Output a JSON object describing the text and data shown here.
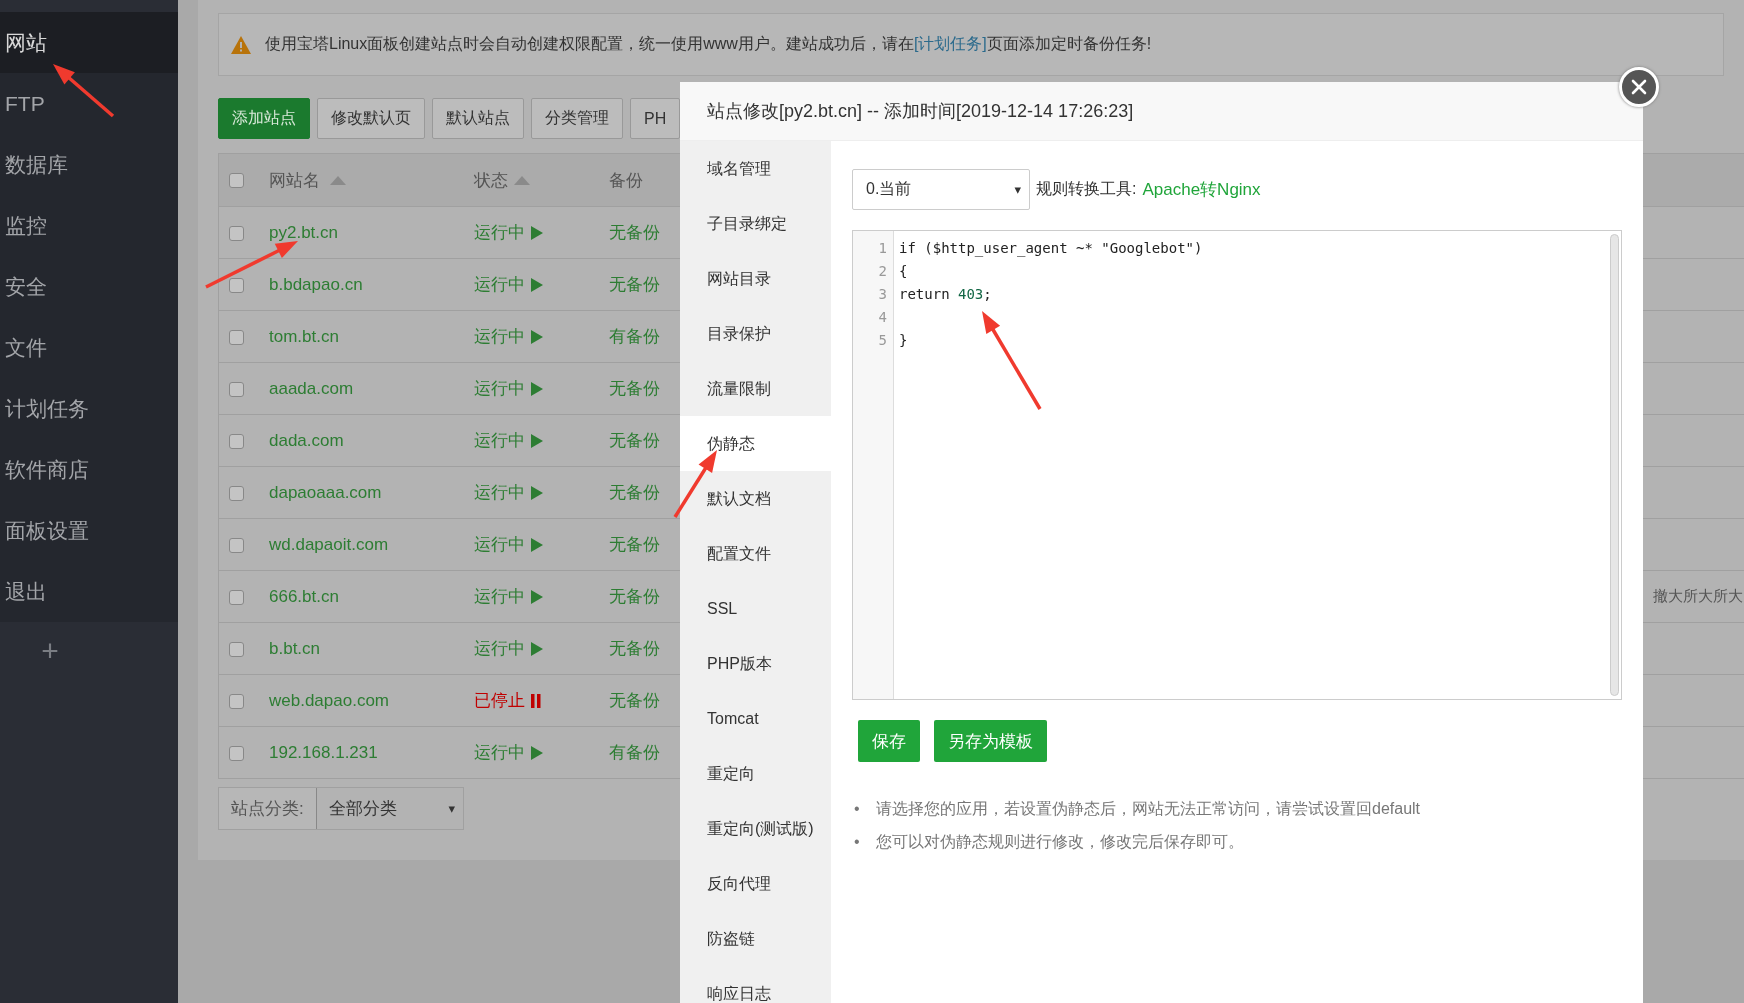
{
  "sidebar": {
    "items": [
      {
        "label": "网站",
        "selected": true
      },
      {
        "label": "FTP",
        "selected": false
      },
      {
        "label": "数据库",
        "selected": false
      },
      {
        "label": "监控",
        "selected": false
      },
      {
        "label": "安全",
        "selected": false
      },
      {
        "label": "文件",
        "selected": false
      },
      {
        "label": "计划任务",
        "selected": false
      },
      {
        "label": "软件商店",
        "selected": false
      },
      {
        "label": "面板设置",
        "selected": false
      },
      {
        "label": "退出",
        "selected": false
      }
    ],
    "add_label": "+"
  },
  "notice": {
    "before": "使用宝塔Linux面板创建站点时会自动创建权限配置，统一使用www用户。建站成功后，请在",
    "link": "[计划任务]",
    "after": "页面添加定时备份任务!"
  },
  "toolbar": [
    {
      "label": "添加站点",
      "kind": "primary"
    },
    {
      "label": "修改默认页",
      "kind": "plain"
    },
    {
      "label": "默认站点",
      "kind": "plain"
    },
    {
      "label": "分类管理",
      "kind": "plain"
    },
    {
      "label": "PH",
      "kind": "plain"
    }
  ],
  "table": {
    "columns": [
      "网站名",
      "状态",
      "备份"
    ],
    "all_checked": false,
    "rows": [
      {
        "checked": false,
        "name": "py2.bt.cn",
        "status": "运行中",
        "running": true,
        "backup": "无备份"
      },
      {
        "checked": false,
        "name": "b.bdapao.cn",
        "status": "运行中",
        "running": true,
        "backup": "无备份"
      },
      {
        "checked": false,
        "name": "tom.bt.cn",
        "status": "运行中",
        "running": true,
        "backup": "有备份"
      },
      {
        "checked": false,
        "name": "aaada.com",
        "status": "运行中",
        "running": true,
        "backup": "无备份"
      },
      {
        "checked": false,
        "name": "dada.com",
        "status": "运行中",
        "running": true,
        "backup": "无备份"
      },
      {
        "checked": false,
        "name": "dapaoaaa.com",
        "status": "运行中",
        "running": true,
        "backup": "无备份"
      },
      {
        "checked": false,
        "name": "wd.dapaoit.com",
        "status": "运行中",
        "running": true,
        "backup": "无备份"
      },
      {
        "checked": false,
        "name": "666.bt.cn",
        "status": "运行中",
        "running": true,
        "backup": "无备份",
        "column_5": "撤大所大所大"
      },
      {
        "checked": false,
        "name": "b.bt.cn",
        "status": "运行中",
        "running": true,
        "backup": "无备份"
      },
      {
        "checked": false,
        "name": "web.dapao.com",
        "status": "已停止",
        "running": false,
        "backup": "无备份"
      },
      {
        "checked": false,
        "name": "192.168.1.231",
        "status": "运行中",
        "running": true,
        "backup": "有备份"
      }
    ]
  },
  "filter": {
    "label": "站点分类:",
    "value": "全部分类",
    "caret": "▾"
  },
  "dialog": {
    "title": "站点修改[py2.bt.cn] -- 添加时间[2019-12-14 17:26:23]",
    "nav": [
      {
        "label": "域名管理",
        "selected": false
      },
      {
        "label": "子目录绑定",
        "selected": false
      },
      {
        "label": "网站目录",
        "selected": false
      },
      {
        "label": "目录保护",
        "selected": false
      },
      {
        "label": "流量限制",
        "selected": false
      },
      {
        "label": "伪静态",
        "selected": true
      },
      {
        "label": "默认文档",
        "selected": false
      },
      {
        "label": "配置文件",
        "selected": false
      },
      {
        "label": "SSL",
        "selected": false
      },
      {
        "label": "PHP版本",
        "selected": false
      },
      {
        "label": "Tomcat",
        "selected": false
      },
      {
        "label": "重定向",
        "selected": false
      },
      {
        "label": "重定向(测试版)",
        "selected": false
      },
      {
        "label": "反向代理",
        "selected": false
      },
      {
        "label": "防盗链",
        "selected": false
      },
      {
        "label": "响应日志",
        "selected": false
      }
    ],
    "template_select": {
      "value": "0.当前",
      "caret": "▾"
    },
    "tool_label": "规则转换工具:",
    "tool_link": "Apache转Nginx",
    "code": [
      {
        "number": "1",
        "tokens": [
          {
            "text": "if ($http_user_agent ~* \"Googlebot\")",
            "kind": "plain"
          }
        ]
      },
      {
        "number": "2",
        "tokens": [
          {
            "text": "{",
            "kind": "plain"
          }
        ]
      },
      {
        "number": "3",
        "tokens": [
          {
            "text": "return ",
            "kind": "plain"
          },
          {
            "text": "403",
            "kind": "number"
          },
          {
            "text": ";",
            "kind": "plain"
          }
        ]
      },
      {
        "number": "4"
      },
      {
        "number": "5",
        "tokens": [
          {
            "text": "}",
            "kind": "plain"
          }
        ]
      }
    ],
    "buttons": [
      "保存",
      "另存为模板"
    ],
    "bullet": "•",
    "notes": [
      "请选择您的应用，若设置伪静态后，网站无法正常访问，请尝试设置回default",
      "您可以对伪静态规则进行修改，修改完后保存即可。"
    ]
  }
}
